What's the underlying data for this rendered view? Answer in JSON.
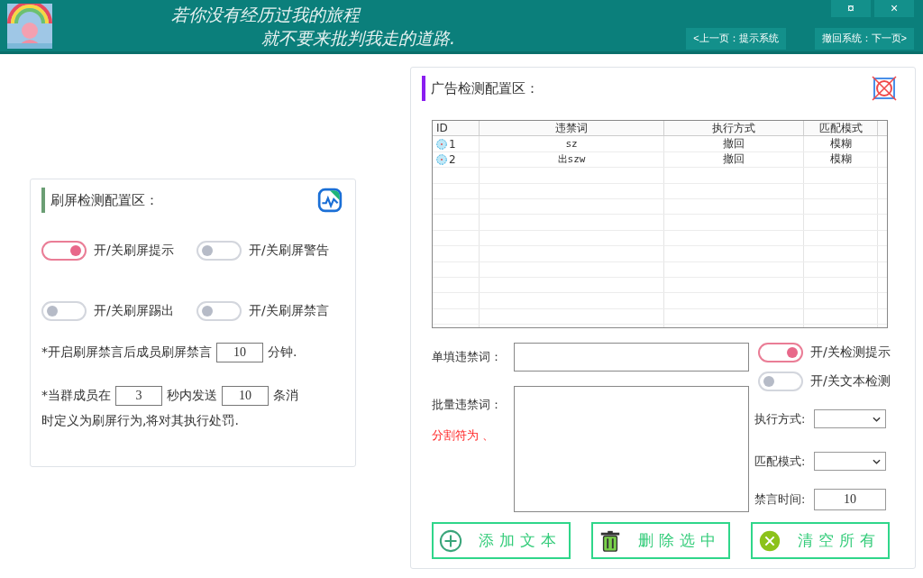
{
  "window": {
    "slogan": [
      "若你没有经历过我的旅程",
      "就不要来批判我走的道路."
    ],
    "controls": [
      "¤",
      "×"
    ],
    "nav_buttons": [
      "<上一页：提示系统",
      "撤回系统：下一页>"
    ]
  },
  "flood_panel": {
    "title": "刷屏检测配置区：",
    "toggles": [
      {
        "label": "开/关刷屏提示",
        "on": true
      },
      {
        "label": "开/关刷屏警告",
        "on": false
      },
      {
        "label": "开/关刷屏踢出",
        "on": false
      },
      {
        "label": "开/关刷屏禁言",
        "on": false
      }
    ],
    "mute_rule": {
      "before": "*开启刷屏禁言后成员刷屏禁言",
      "minutes": "10",
      "after": "分钟."
    },
    "rate_rule": {
      "before": "*当群成员在",
      "seconds": "3",
      "middle": "秒内发送",
      "count": "10",
      "after": "条消",
      "continuation": "时定义为刷屏行为,将对其执行处罚."
    }
  },
  "ad_panel": {
    "title": "广告检测配置区：",
    "table": {
      "columns": [
        "ID",
        "违禁词",
        "执行方式",
        "匹配模式"
      ],
      "rows": [
        {
          "id": "1",
          "word": "sz",
          "action": "撤回",
          "mode": "模糊"
        },
        {
          "id": "2",
          "word": "出szw",
          "action": "撤回",
          "mode": "模糊"
        }
      ]
    },
    "single_word": {
      "label": "单填违禁词："
    },
    "batch_words": {
      "label": "批量违禁词：",
      "hint": "分割符为 、"
    },
    "toggles": [
      {
        "label": "开/关检测提示",
        "on": true
      },
      {
        "label": "开/关文本检测",
        "on": false
      }
    ],
    "action_select": {
      "label": "执行方式:"
    },
    "mode_select": {
      "label": "匹配模式:"
    },
    "mute_time": {
      "label": "禁言时间:",
      "value": "10"
    },
    "buttons": [
      {
        "label": "添加文本",
        "kind": "add"
      },
      {
        "label": "删除选中",
        "kind": "delete"
      },
      {
        "label": "清空所有",
        "kind": "clear"
      }
    ]
  }
}
